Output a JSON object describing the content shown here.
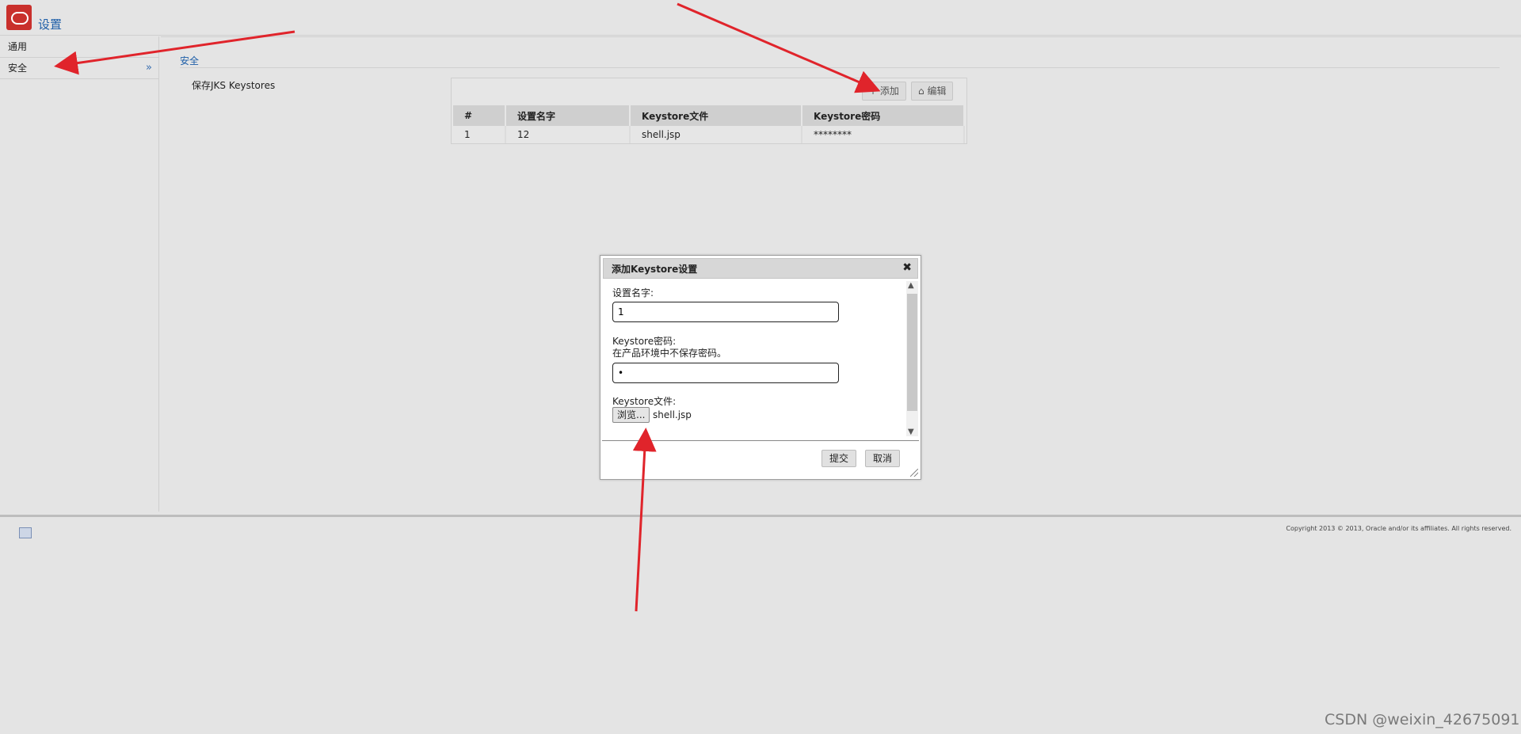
{
  "header": {
    "title": "设置"
  },
  "sidebar": {
    "items": [
      {
        "label": "通用"
      },
      {
        "label": "安全"
      }
    ]
  },
  "main": {
    "section_title": "安全",
    "jks_label": "保存JKS Keystores",
    "toolbar": {
      "add_label": "添加",
      "edit_label": "编辑"
    },
    "table": {
      "headers": [
        "#",
        "设置名字",
        "Keystore文件",
        "Keystore密码"
      ],
      "rows": [
        [
          "1",
          "12",
          "shell.jsp",
          "********"
        ]
      ]
    }
  },
  "dialog": {
    "title": "添加Keystore设置",
    "name_label": "设置名字:",
    "name_value": "1",
    "password_label": "Keystore密码:",
    "password_hint": "在产品环境中不保存密码。",
    "password_value": "•",
    "file_label": "Keystore文件:",
    "browse_label": "浏览...",
    "file_name": "shell.jsp",
    "submit_label": "提交",
    "cancel_label": "取消"
  },
  "footer": {
    "copyright": "Copyright 2013 © 2013, Oracle and/or its affiliates. All rights reserved."
  },
  "watermark": "CSDN @weixin_42675091",
  "colors": {
    "accent": "#1d5ea8",
    "annotation": "#e0242b"
  }
}
